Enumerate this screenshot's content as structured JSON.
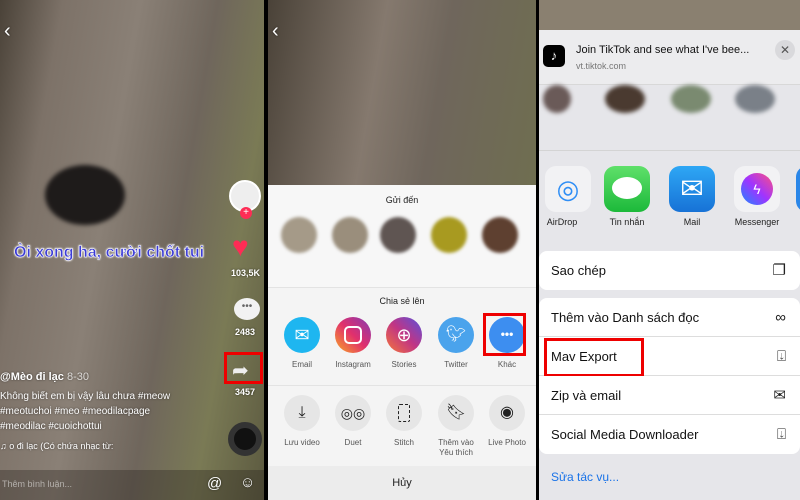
{
  "panel1": {
    "caption": "Òi xong ha, cười chốt tui",
    "likes": "103,5K",
    "comments": "2483",
    "shares": "3457",
    "username": "@Mèo đi lạc",
    "date": "8-30",
    "description": [
      "Không biết em bị vậy lâu chưa #meow",
      "#meotuchoi #meo #meodilacpage",
      "#meodilac #cuoichottui"
    ],
    "music": "o đi lạc (Có chứa nhạc từ:",
    "comment_placeholder": "Thêm bình luận...",
    "colors": {
      "caption": "#3b3bd6",
      "like": "#fe2c55",
      "highlight": "#ee0000"
    }
  },
  "panel2": {
    "send_title": "Gửi đến",
    "share_title": "Chia sẻ lên",
    "share_targets": [
      {
        "label": "Email",
        "icon": "mail-icon"
      },
      {
        "label": "Instagram",
        "icon": "instagram-icon"
      },
      {
        "label": "Stories",
        "icon": "stories-icon"
      },
      {
        "label": "Twitter",
        "icon": "twitter-icon"
      },
      {
        "label": "Khác",
        "icon": "more-icon"
      }
    ],
    "actions": [
      {
        "label": "Lưu video",
        "icon": "download-icon"
      },
      {
        "label": "Duet",
        "icon": "duet-icon"
      },
      {
        "label": "Stitch",
        "icon": "stitch-icon"
      },
      {
        "label": "Thêm vào",
        "label2": "Yêu thích",
        "icon": "bookmark-icon"
      },
      {
        "label": "Live Photo",
        "icon": "live-photo-icon"
      }
    ],
    "cancel": "Hủy"
  },
  "panel3": {
    "header_title": "Join TikTok and see what I've bee...",
    "header_url": "vt.tiktok.com",
    "apps": [
      {
        "label": "AirDrop",
        "icon": "airdrop-icon"
      },
      {
        "label": "Tin nhắn",
        "icon": "messages-icon"
      },
      {
        "label": "Mail",
        "icon": "mail-icon"
      },
      {
        "label": "Messenger",
        "icon": "messenger-icon"
      }
    ],
    "copy": "Sao chép",
    "actions": [
      {
        "label": "Thêm vào Danh sách đọc",
        "icon": "glasses-icon"
      },
      {
        "label": "Mav Export",
        "icon": "save-icon"
      },
      {
        "label": "Zip và email",
        "icon": "envelope-icon"
      },
      {
        "label": "Social Media Downloader",
        "icon": "save-icon"
      }
    ],
    "edit_actions": "Sửa tác vụ..."
  }
}
